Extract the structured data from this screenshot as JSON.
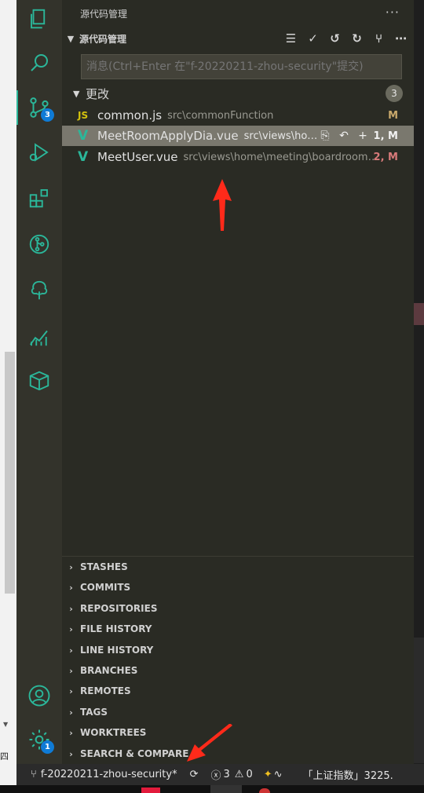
{
  "sidebar": {
    "title": "源代码管理",
    "more": "···",
    "section": {
      "title": "源代码管理",
      "toolbar": [
        "list-flat-icon",
        "check-icon",
        "history-icon",
        "refresh-icon",
        "graph-icon",
        "ellipsis-icon"
      ]
    },
    "message_placeholder": "消息(Ctrl+Enter 在\"f-20220211-zhou-security\"提交)",
    "changes": {
      "label": "更改",
      "count": "3",
      "files": [
        {
          "icon": "JS",
          "name": "common.js",
          "path": "src\\commonFunction",
          "status": "M"
        },
        {
          "icon": "V",
          "name": "MeetRoomApplyDia.vue",
          "path": "src\\views\\home...",
          "status": "1, M"
        },
        {
          "icon": "V",
          "name": "MeetUser.vue",
          "path": "src\\views\\home\\meeting\\boardroom\\...",
          "status": "2, M"
        }
      ]
    },
    "sections": [
      "STASHES",
      "COMMITS",
      "REPOSITORIES",
      "FILE HISTORY",
      "LINE HISTORY",
      "BRANCHES",
      "REMOTES",
      "TAGS",
      "WORKTREES",
      "SEARCH & COMPARE"
    ]
  },
  "activity_bar": {
    "scm_badge": "3",
    "settings_badge": "1"
  },
  "statusbar": {
    "branch": "f-20220211-zhou-security*",
    "errors": "3",
    "warnings": "0",
    "stock": "「上证指数」3225."
  },
  "left_strip_text": "四",
  "colors": {
    "accent": "#2bb79a",
    "badge": "#0f7bd6",
    "annotation": "#ff2a1a"
  }
}
